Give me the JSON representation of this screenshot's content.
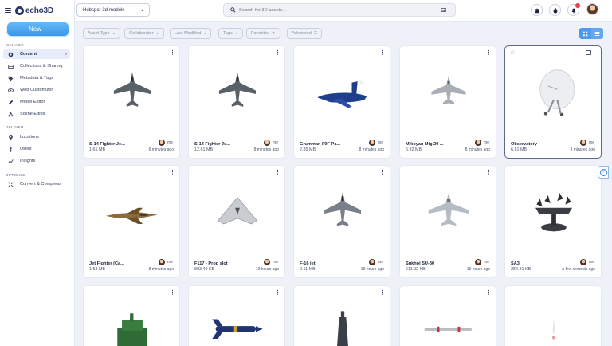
{
  "app": {
    "brand": "echo3D"
  },
  "sidebar": {
    "new_button": "New +",
    "manage_label": "MANAGE",
    "deliver_label": "DELIVER",
    "optimize_label": "OPTIMIZE",
    "items": [
      {
        "label": "Content",
        "icon": "content-icon"
      },
      {
        "label": "Collections & Sharing",
        "icon": "collections-icon"
      },
      {
        "label": "Metadata & Tags",
        "icon": "tag-icon"
      },
      {
        "label": "Web Customizer",
        "icon": "eye-icon"
      },
      {
        "label": "Model Editor",
        "icon": "pencil-icon"
      },
      {
        "label": "Scene Editor",
        "icon": "shapes-icon"
      },
      {
        "label": "Locations",
        "icon": "location-pin-icon"
      },
      {
        "label": "Users",
        "icon": "user-icon"
      },
      {
        "label": "Insights",
        "icon": "insights-icon"
      },
      {
        "label": "Convert & Compress",
        "icon": "compress-icon"
      }
    ]
  },
  "topbar": {
    "project": "Hubspot-3d-models",
    "search_placeholder": "Search for 3D assets..."
  },
  "filters": {
    "asset_type": "Asset Type",
    "collaborator": "Collaborator",
    "last_modified": "Last Modified",
    "tags": "Tags",
    "favorites": "Favorites",
    "advanced": "Advanced"
  },
  "assets": [
    {
      "name": "S-14 Fighter Je...",
      "size": "1.61 MB",
      "owner": "me",
      "time": "6 minutes ago"
    },
    {
      "name": "S-14 Fighter Je...",
      "size": "12.61 MB",
      "owner": "me",
      "time": "8 minutes ago"
    },
    {
      "name": "Grumman F9F Pa...",
      "size": "2.85 MB",
      "owner": "me",
      "time": "8 minutes ago"
    },
    {
      "name": "Mikoyan Mig 29 ...",
      "size": "5.92 MB",
      "owner": "me",
      "time": "8 minutes ago"
    },
    {
      "name": "Observatory",
      "size": "6.81 MB",
      "owner": "me",
      "time": "8 minutes ago"
    },
    {
      "name": "Jet Fighter (Ca...",
      "size": "1.53 MB",
      "owner": "me",
      "time": "8 minutes ago"
    },
    {
      "name": "F117 - Prop slot",
      "size": "803.49 KB",
      "owner": "me",
      "time": "19 hours ago"
    },
    {
      "name": "F-16 jet",
      "size": "2.11 MB",
      "owner": "me",
      "time": "19 hours ago"
    },
    {
      "name": "Sukhoi SU-30",
      "size": "611.92 KB",
      "owner": "me",
      "time": "19 hours ago"
    },
    {
      "name": "SA3",
      "size": "254.81 KB",
      "owner": "me",
      "time": "a few seconds ago"
    },
    {
      "name": "",
      "size": "",
      "owner": "",
      "time": ""
    },
    {
      "name": "",
      "size": "",
      "owner": "",
      "time": ""
    },
    {
      "name": "",
      "size": "",
      "owner": "",
      "time": ""
    },
    {
      "name": "",
      "size": "",
      "owner": "",
      "time": ""
    },
    {
      "name": "",
      "size": "",
      "owner": "",
      "time": ""
    }
  ]
}
